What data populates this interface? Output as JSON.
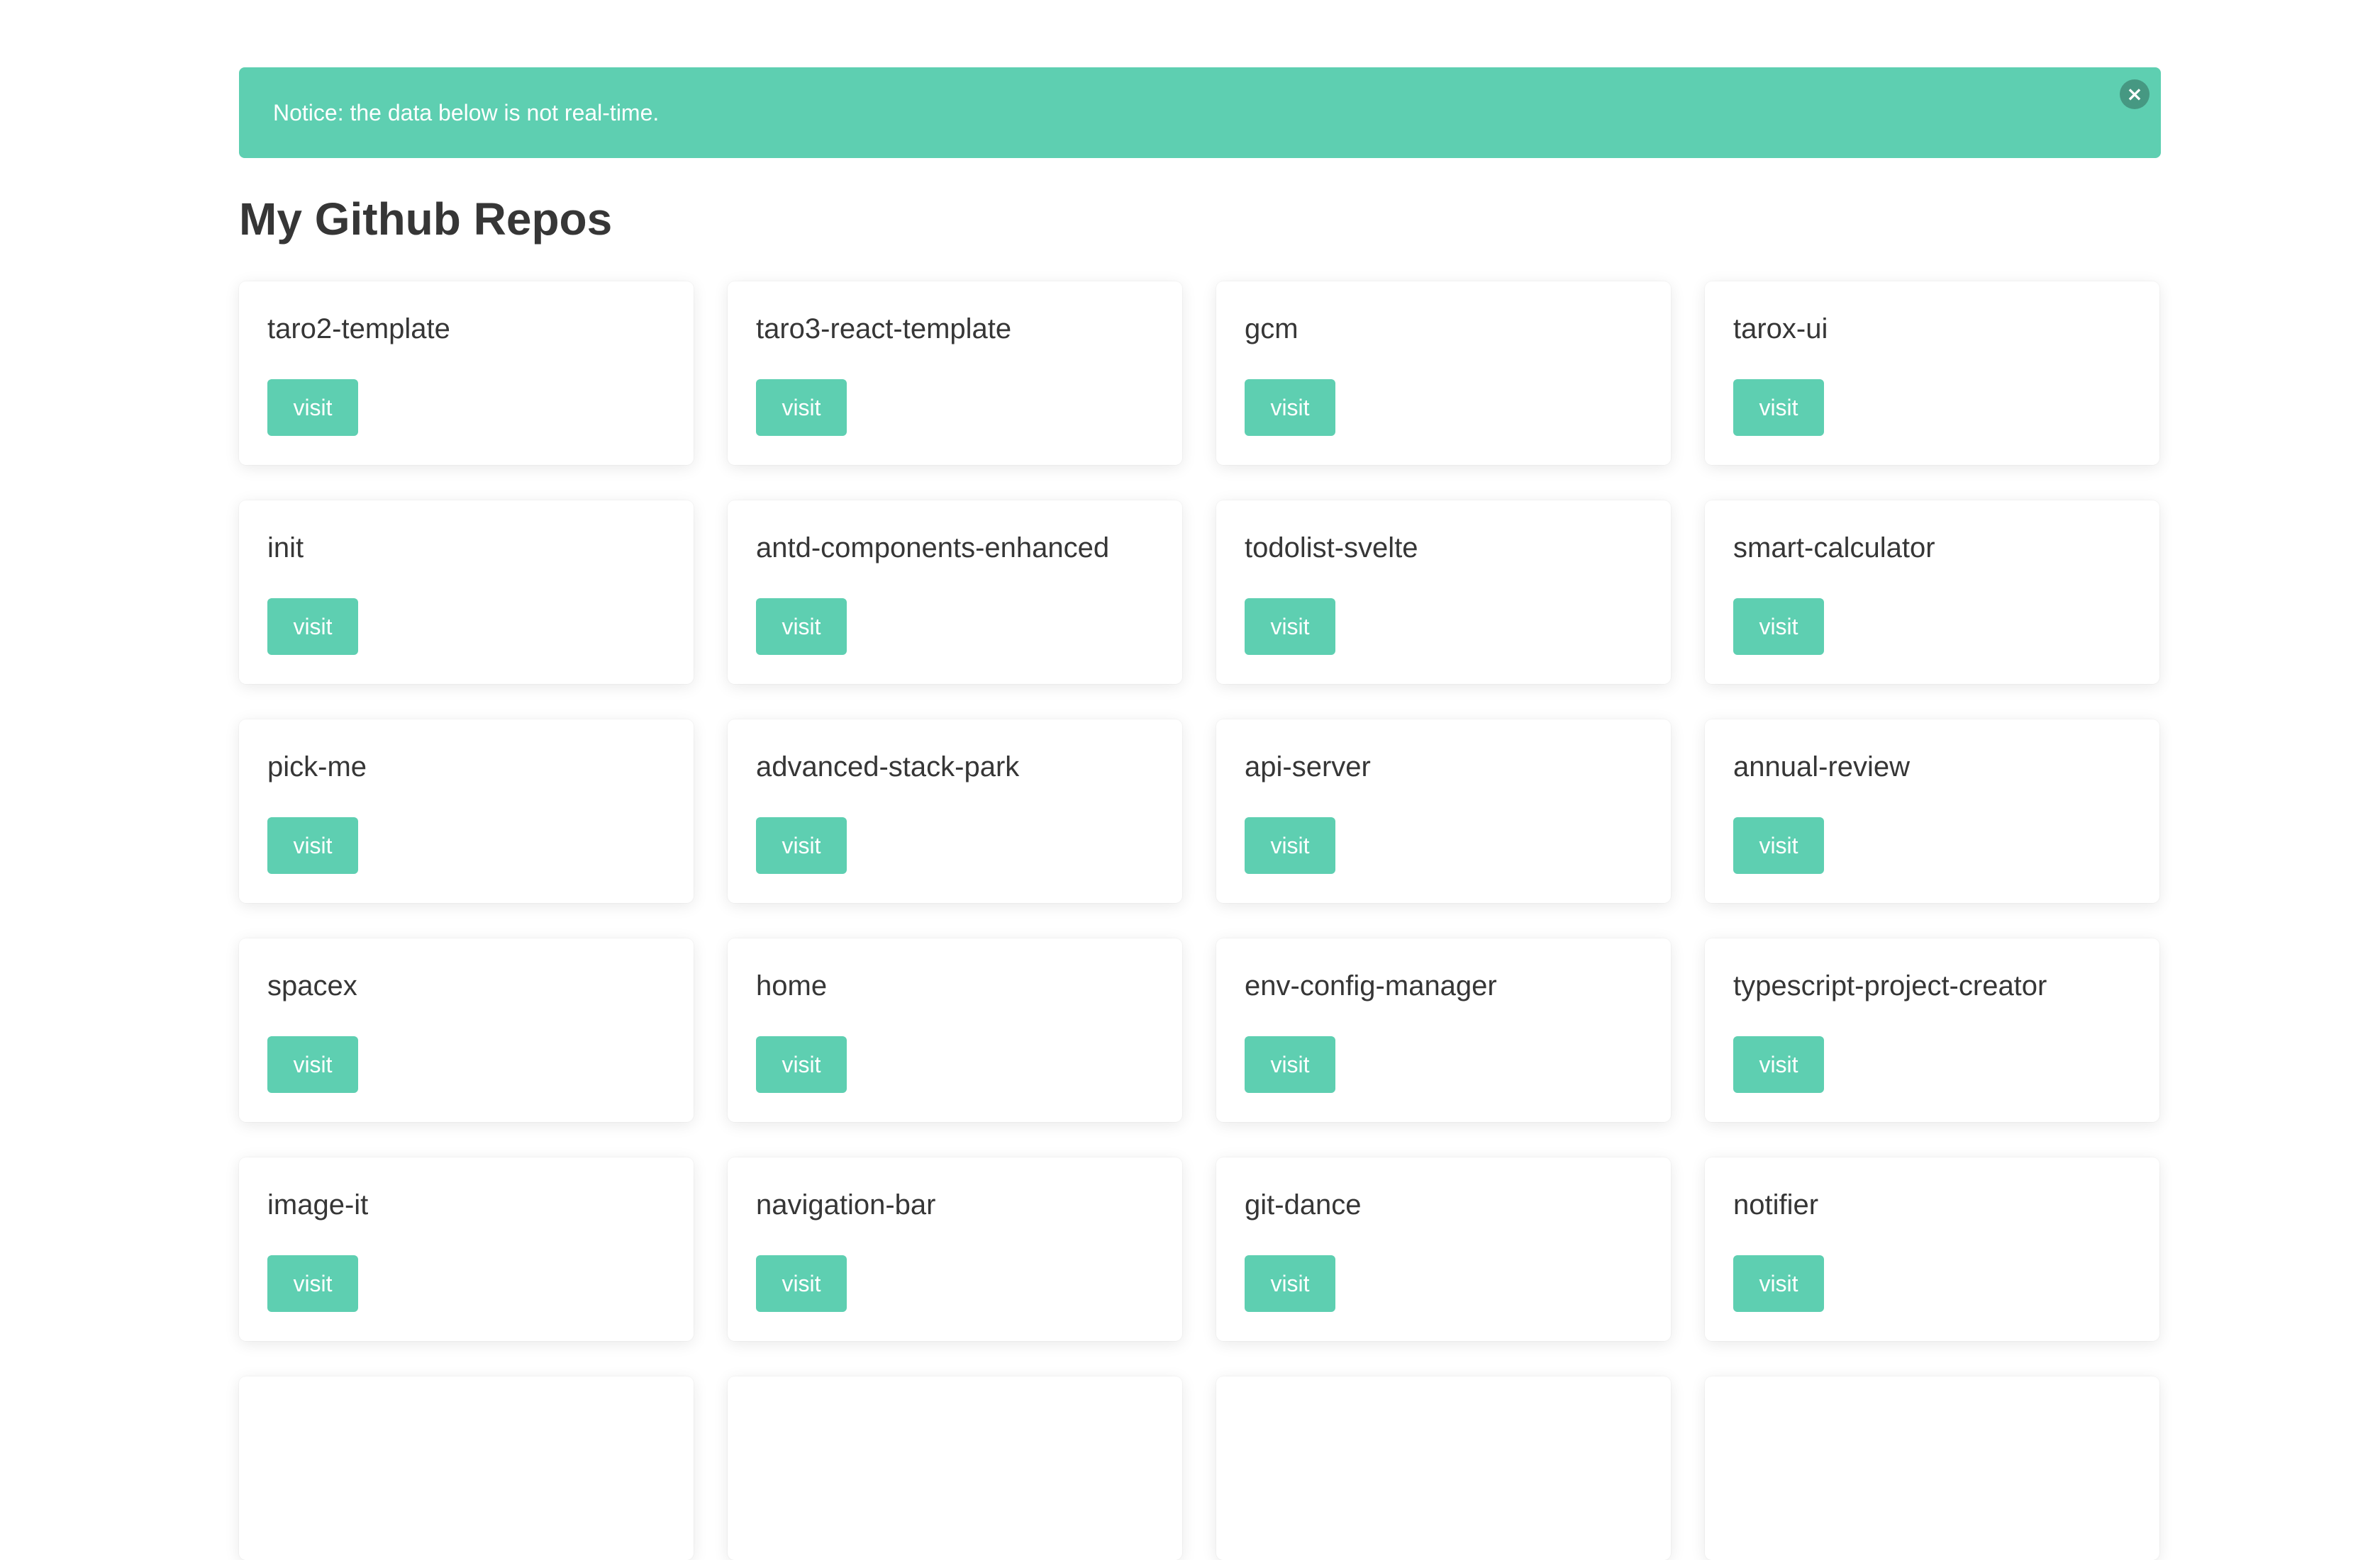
{
  "notice": {
    "text": "Notice: the data below is not real-time.",
    "close_icon": "×"
  },
  "page_title": "My Github Repos",
  "colors": {
    "accent": "#5ecfb1",
    "text": "#363636",
    "background": "#ffffff"
  },
  "repos": [
    {
      "name": "taro2-template",
      "button": "visit"
    },
    {
      "name": "taro3-react-template",
      "button": "visit"
    },
    {
      "name": "gcm",
      "button": "visit"
    },
    {
      "name": "tarox-ui",
      "button": "visit"
    },
    {
      "name": "init",
      "button": "visit"
    },
    {
      "name": "antd-components-enhanced",
      "button": "visit"
    },
    {
      "name": "todolist-svelte",
      "button": "visit"
    },
    {
      "name": "smart-calculator",
      "button": "visit"
    },
    {
      "name": "pick-me",
      "button": "visit"
    },
    {
      "name": "advanced-stack-park",
      "button": "visit"
    },
    {
      "name": "api-server",
      "button": "visit"
    },
    {
      "name": "annual-review",
      "button": "visit"
    },
    {
      "name": "spacex",
      "button": "visit"
    },
    {
      "name": "home",
      "button": "visit"
    },
    {
      "name": "env-config-manager",
      "button": "visit"
    },
    {
      "name": "typescript-project-creator",
      "button": "visit"
    },
    {
      "name": "image-it",
      "button": "visit"
    },
    {
      "name": "navigation-bar",
      "button": "visit"
    },
    {
      "name": "git-dance",
      "button": "visit"
    },
    {
      "name": "notifier",
      "button": "visit"
    },
    {
      "name": "",
      "button": ""
    },
    {
      "name": "",
      "button": ""
    },
    {
      "name": "",
      "button": ""
    },
    {
      "name": "",
      "button": ""
    }
  ]
}
